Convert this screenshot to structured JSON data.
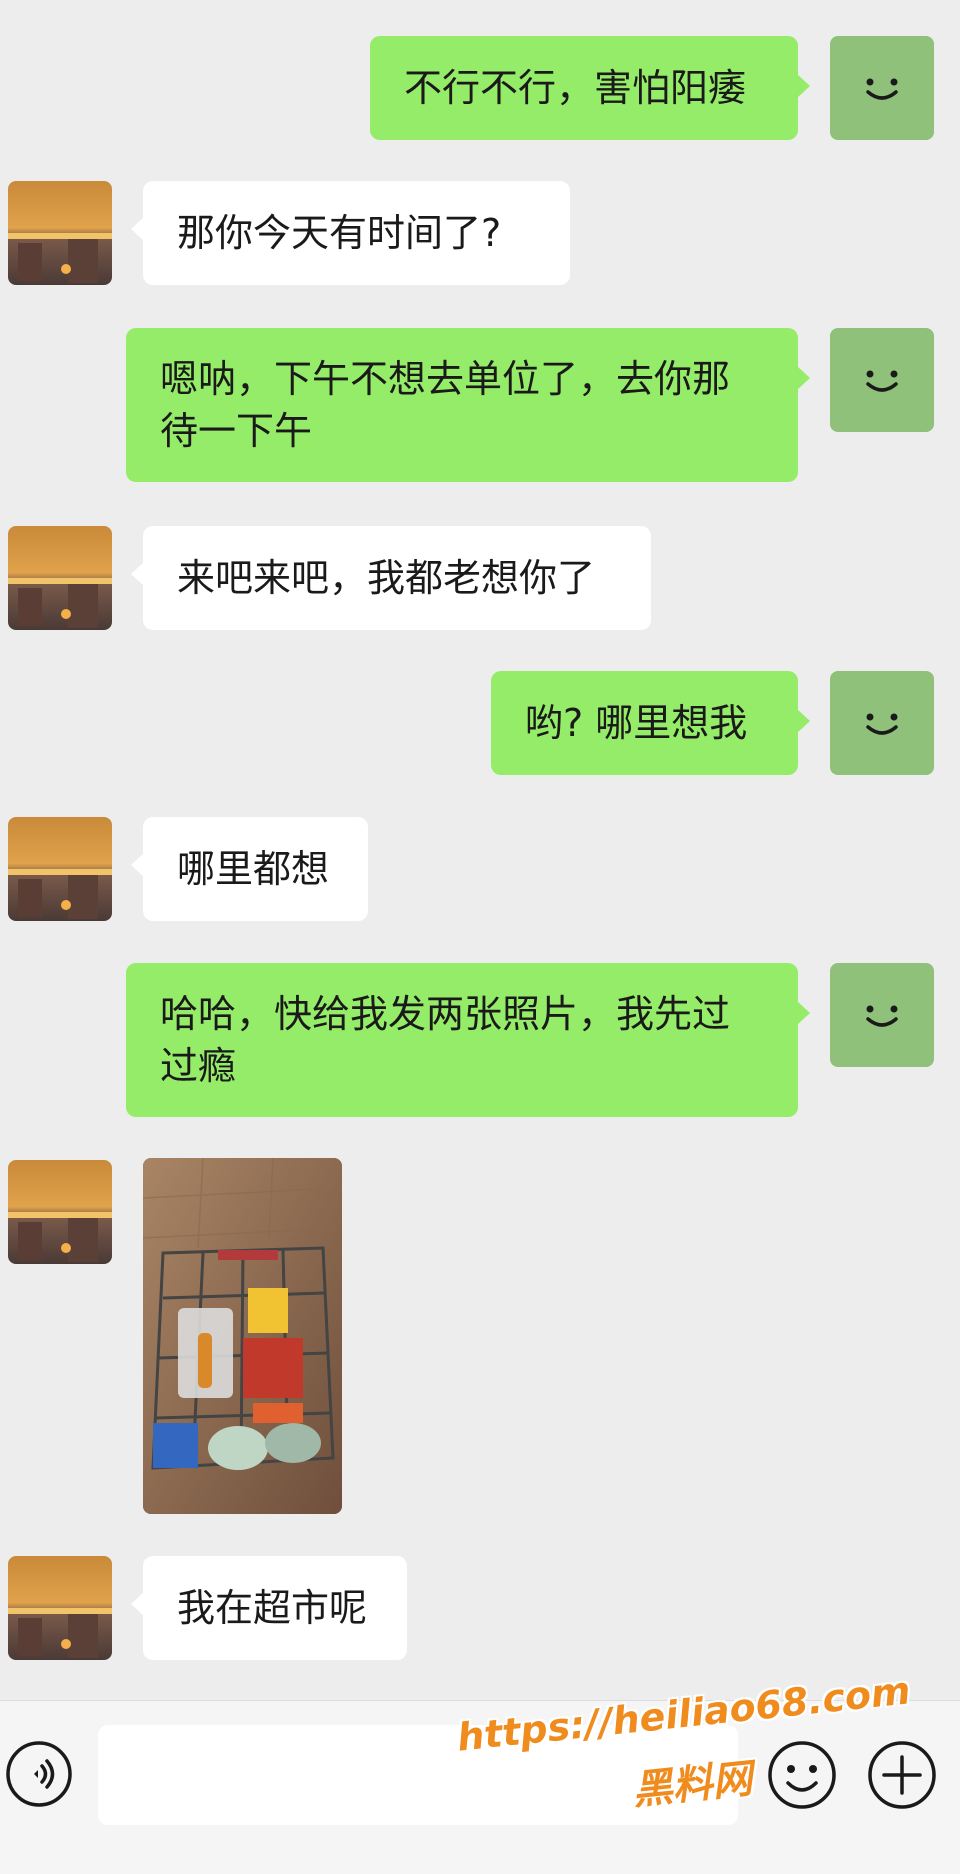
{
  "messages": [
    {
      "side": "out",
      "text": "不行不行，害怕阳痿"
    },
    {
      "side": "in",
      "text": "那你今天有时间了?"
    },
    {
      "side": "out",
      "line1": "嗯呐，下午不想去单位了，去你那",
      "line2": "待一下午"
    },
    {
      "side": "in",
      "text": "来吧来吧，我都老想你了"
    },
    {
      "side": "out",
      "text": "哟? 哪里想我"
    },
    {
      "side": "in",
      "text": "哪里都想"
    },
    {
      "side": "out",
      "line1": "哈哈，快给我发两张照片，我先过",
      "line2": "过瘾"
    },
    {
      "side": "in",
      "type": "image",
      "description_icon": "shopping-cart-photo"
    },
    {
      "side": "in",
      "text": "我在超市呢"
    }
  ],
  "watermark": {
    "line1": "https://heiliao68.com",
    "line2": "黑料网"
  },
  "input": {
    "placeholder": ""
  },
  "colors": {
    "background": "#ededed",
    "outgoing_bubble": "#95ec69",
    "incoming_bubble": "#ffffff",
    "watermark": "#f08c1e"
  },
  "icons": {
    "voice": "voice-icon",
    "emoji": "emoji-icon",
    "plus": "plus-icon",
    "self_avatar": "smiley-avatar"
  }
}
